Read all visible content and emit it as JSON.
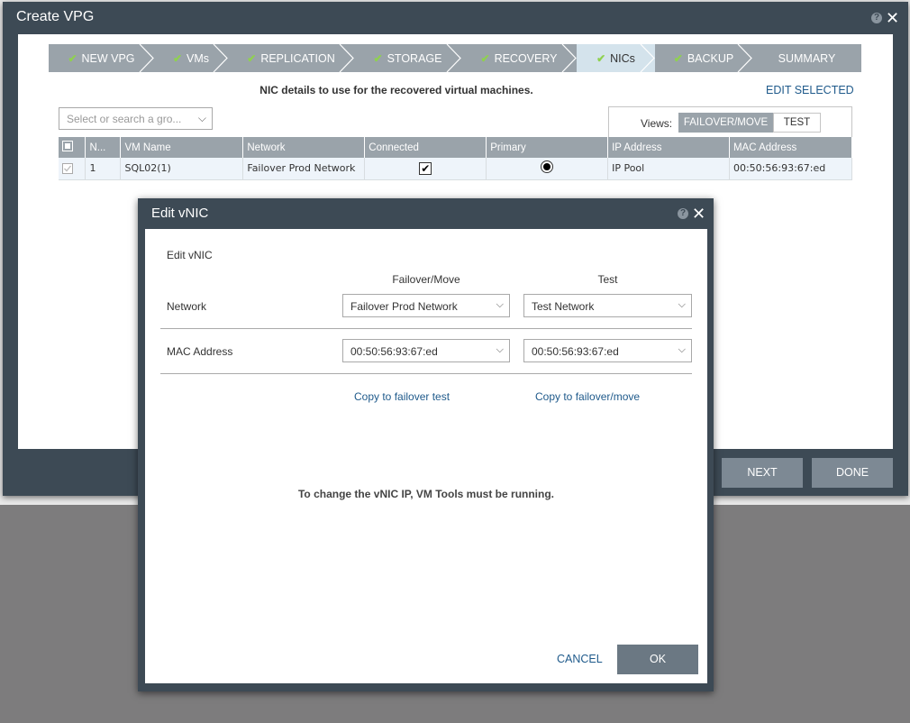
{
  "outer": {
    "title": "Create VPG",
    "steps": [
      {
        "label": "NEW VPG",
        "done": true
      },
      {
        "label": "VMs",
        "done": true
      },
      {
        "label": "REPLICATION",
        "done": true
      },
      {
        "label": "STORAGE",
        "done": true
      },
      {
        "label": "RECOVERY",
        "done": true
      },
      {
        "label": "NICs",
        "done": true,
        "active": true
      },
      {
        "label": "BACKUP",
        "done": true
      },
      {
        "label": "SUMMARY",
        "done": false
      }
    ],
    "nic_title": "NIC details to use for the recovered virtual machines.",
    "edit_selected": "EDIT SELECTED",
    "search_placeholder": "Select or search a gro...",
    "views": {
      "label": "Views:",
      "option_a": "FAILOVER/MOVE",
      "option_b": "TEST"
    },
    "table": {
      "headers": [
        "N...",
        "VM Name",
        "Network",
        "Connected",
        "Primary",
        "IP Address",
        "MAC Address"
      ],
      "rows": [
        {
          "n": "1",
          "vm_name": "SQL02(1)",
          "network": "Failover Prod Network",
          "ip": "IP Pool",
          "mac": "00:50:56:93:67:ed"
        }
      ]
    },
    "next_label": "NEXT",
    "done_label": "DONE"
  },
  "dialog": {
    "title": "Edit vNIC",
    "section": "Edit vNIC",
    "col_failover": "Failover/Move",
    "col_test": "Test",
    "network_label": "Network",
    "network_failover": "Failover Prod Network",
    "network_test": "Test Network",
    "mac_label": "MAC Address",
    "mac_failover": "00:50:56:93:67:ed",
    "mac_test": "00:50:56:93:67:ed",
    "copy_to_test": "Copy to failover test",
    "copy_to_failover": "Copy to failover/move",
    "note": "To change the vNIC IP, VM Tools must be running.",
    "cancel_label": "CANCEL",
    "ok_label": "OK"
  }
}
